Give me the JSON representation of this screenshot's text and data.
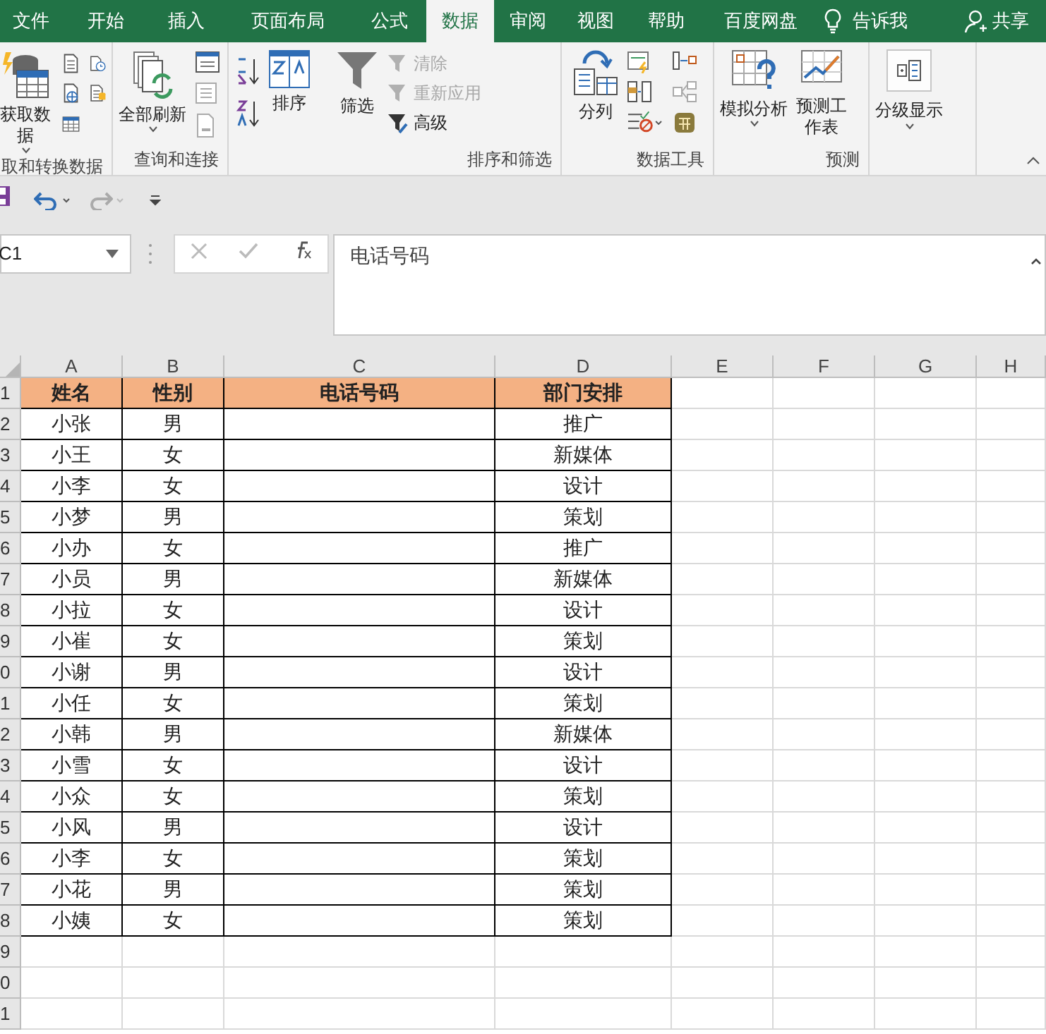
{
  "tabs": [
    {
      "label": "文件",
      "selected": false
    },
    {
      "label": "开始",
      "selected": false
    },
    {
      "label": "插入",
      "selected": false
    },
    {
      "label": "页面布局",
      "selected": false
    },
    {
      "label": "公式",
      "selected": false
    },
    {
      "label": "数据",
      "selected": true
    },
    {
      "label": "审阅",
      "selected": false
    },
    {
      "label": "视图",
      "selected": false
    },
    {
      "label": "帮助",
      "selected": false
    },
    {
      "label": "百度网盘",
      "selected": false
    }
  ],
  "tell_me": "告诉我",
  "share": "共享",
  "ribbon": {
    "get_data": "获取数据",
    "group_get": "取和转换数据",
    "refresh_all": "全部刷新",
    "group_query": "查询和连接",
    "sort": "排序",
    "filter": "筛选",
    "filter_options": [
      {
        "label": "清除",
        "disabled": true
      },
      {
        "label": "重新应用",
        "disabled": true
      },
      {
        "label": "高级",
        "disabled": false
      }
    ],
    "group_sort": "排序和筛选",
    "text_to_columns": "分列",
    "group_tools": "数据工具",
    "what_if": "模拟分析",
    "forecast_sheet": "预测工作表",
    "group_forecast": "预测",
    "outline": "分级显示"
  },
  "formula_bar": {
    "name_box": "C1",
    "formula": "电话号码"
  },
  "sheet": {
    "columns": [
      "A",
      "B",
      "C",
      "D",
      "E",
      "F",
      "G",
      "H"
    ],
    "header": {
      "row_label": "1",
      "cells": [
        "姓名",
        "性别",
        "电话号码",
        "部门安排"
      ]
    },
    "rows": [
      {
        "row_label": "2",
        "name": "小张",
        "gender": "男",
        "department": "推广"
      },
      {
        "row_label": "3",
        "name": "小王",
        "gender": "女",
        "department": "新媒体"
      },
      {
        "row_label": "4",
        "name": "小李",
        "gender": "女",
        "department": "设计"
      },
      {
        "row_label": "5",
        "name": "小梦",
        "gender": "男",
        "department": "策划"
      },
      {
        "row_label": "6",
        "name": "小办",
        "gender": "女",
        "department": "推广"
      },
      {
        "row_label": "7",
        "name": "小员",
        "gender": "男",
        "department": "新媒体"
      },
      {
        "row_label": "8",
        "name": "小拉",
        "gender": "女",
        "department": "设计"
      },
      {
        "row_label": "9",
        "name": "小崔",
        "gender": "女",
        "department": "策划"
      },
      {
        "row_label": "0",
        "name": "小谢",
        "gender": "男",
        "department": "设计"
      },
      {
        "row_label": "1",
        "name": "小任",
        "gender": "女",
        "department": "策划"
      },
      {
        "row_label": "2",
        "name": "小韩",
        "gender": "男",
        "department": "新媒体"
      },
      {
        "row_label": "3",
        "name": "小雪",
        "gender": "女",
        "department": "设计"
      },
      {
        "row_label": "4",
        "name": "小众",
        "gender": "女",
        "department": "策划"
      },
      {
        "row_label": "5",
        "name": "小风",
        "gender": "男",
        "department": "设计"
      },
      {
        "row_label": "6",
        "name": "小李",
        "gender": "女",
        "department": "策划"
      },
      {
        "row_label": "7",
        "name": "小花",
        "gender": "男",
        "department": "策划"
      },
      {
        "row_label": "8",
        "name": "小姨",
        "gender": "女",
        "department": "策划"
      },
      {
        "row_label": "9"
      },
      {
        "row_label": "0"
      },
      {
        "row_label": "1"
      }
    ]
  }
}
